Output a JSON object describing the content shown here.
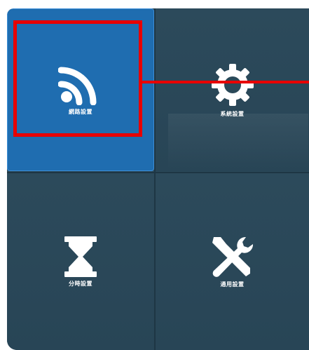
{
  "tiles": {
    "network": {
      "label": "網路設置",
      "icon": "wifi-icon"
    },
    "system": {
      "label": "系統設置",
      "icon": "gear-icon"
    },
    "timer": {
      "label": "分時設置",
      "icon": "hourglass-icon"
    },
    "general": {
      "label": "通用設置",
      "icon": "tools-icon"
    }
  },
  "colors": {
    "selected_tile": "#1f6db0",
    "tile": "#2a4859",
    "highlight": "#e80000"
  }
}
